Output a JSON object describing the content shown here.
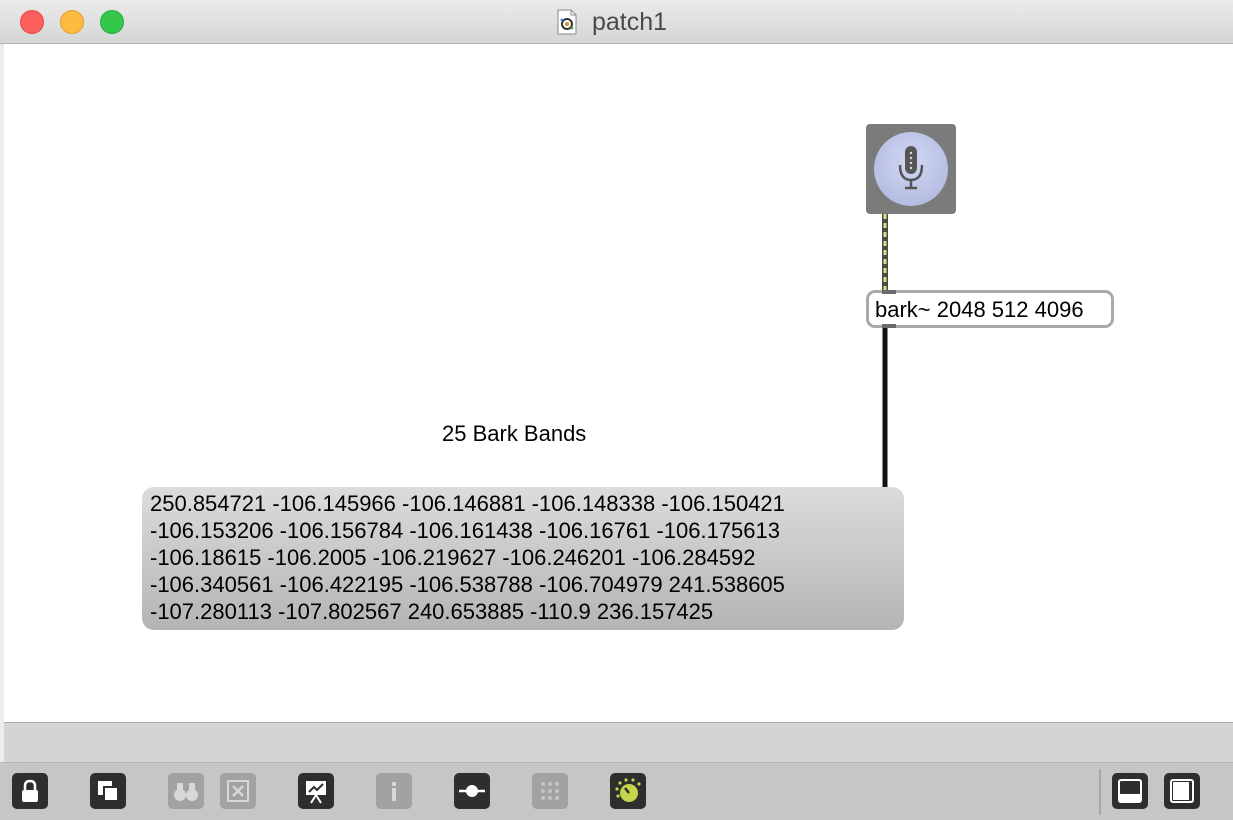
{
  "window": {
    "title": "patch1"
  },
  "patch": {
    "adc_object": {
      "icon": "microphone-icon"
    },
    "bark_object": {
      "text": "bark~ 2048 512 4096"
    },
    "comment": {
      "text": "25 Bark Bands"
    },
    "message_box": {
      "lines": [
        "250.854721 -106.145966 -106.146881 -106.148338 -106.150421",
        "-106.153206 -106.156784 -106.161438 -106.16761 -106.175613",
        "-106.18615 -106.2005 -106.219627 -106.246201 -106.284592",
        "-106.340561 -106.422195 -106.538788 -106.704979 241.538605",
        "-107.280113 -107.802567 240.653885 -110.9 236.157425"
      ]
    }
  },
  "toolbar": {
    "buttons": [
      {
        "name": "lock-icon",
        "enabled": true
      },
      {
        "name": "new-object-icon",
        "enabled": true
      },
      {
        "name": "binoculars-icon",
        "enabled": false
      },
      {
        "name": "delete-icon",
        "enabled": false
      },
      {
        "name": "presentation-icon",
        "enabled": true
      },
      {
        "name": "info-icon",
        "enabled": false
      },
      {
        "name": "slider-icon",
        "enabled": true
      },
      {
        "name": "grid-icon",
        "enabled": false
      },
      {
        "name": "dsp-knob-icon",
        "enabled": true
      },
      {
        "name": "bottom-panel-icon",
        "enabled": true
      },
      {
        "name": "side-panel-icon",
        "enabled": true
      }
    ]
  },
  "colors": {
    "signal_cord": "#c9e68a",
    "control_cord": "#111111",
    "dsp_knob": "#c6d44a"
  }
}
